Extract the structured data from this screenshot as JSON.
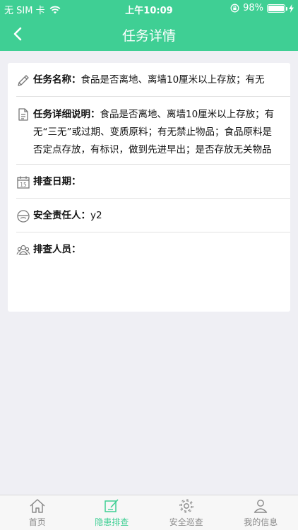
{
  "status_bar": {
    "carrier": "无 SIM 卡",
    "time": "上午10:09",
    "battery_percent": "98%",
    "battery_level": 0.98
  },
  "nav": {
    "title": "任务详情"
  },
  "task": {
    "name_label": "任务名称：",
    "name_value": "食品是否离地、离墙10厘米以上存放；有无",
    "description_label": "任务详细说明：",
    "description_value": "食品是否离地、离墙10厘米以上存放；有无“三无”或过期、变质原料；有无禁止物品；食品原料是否定点存放，有标识，做到先进早出；是否存放无关物品",
    "date_label": "排查日期：",
    "date_value": "",
    "responsible_label": "安全责任人：",
    "responsible_value": "y2",
    "personnel_label": "排查人员：",
    "personnel_value": ""
  },
  "tabs": [
    {
      "label": "首页",
      "icon": "home-icon"
    },
    {
      "label": "隐患排查",
      "icon": "edit-icon"
    },
    {
      "label": "安全巡查",
      "icon": "gear-icon"
    },
    {
      "label": "我的信息",
      "icon": "user-icon"
    }
  ],
  "colors": {
    "primary": "#3fcf94",
    "background": "#efeff4",
    "tab_inactive": "#8a8a8a"
  }
}
